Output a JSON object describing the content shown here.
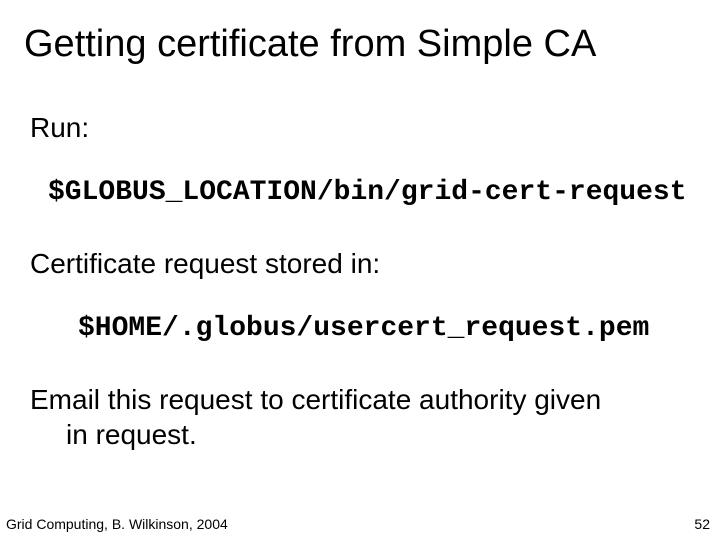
{
  "title": "Getting certificate from Simple CA",
  "p1": "Run:",
  "code1": "$GLOBUS_LOCATION/bin/grid-cert-request",
  "p2": "Certificate request stored in:",
  "code2": "$HOME/.globus/usercert_request.pem",
  "p3a": "Email this request to certificate authority given",
  "p3b": "in request.",
  "footer": "Grid Computing, B. Wilkinson, 2004",
  "pagenum": "52"
}
